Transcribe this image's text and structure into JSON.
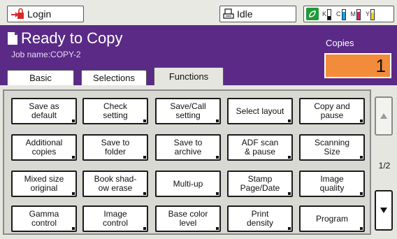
{
  "status_bar": {
    "login_label": "Login",
    "status_label": "Idle",
    "toner": [
      {
        "letter": "K",
        "level": 0.35,
        "color": "#111111"
      },
      {
        "letter": "C",
        "level": 0.8,
        "color": "#1aa0e0"
      },
      {
        "letter": "M",
        "level": 0.8,
        "color": "#d4237a"
      },
      {
        "letter": "Y",
        "level": 0.75,
        "color": "#f2d21a"
      }
    ]
  },
  "header": {
    "title": "Ready to Copy",
    "job_name": "Job name:COPY-2",
    "copies_label": "Copies",
    "copies_value": "1"
  },
  "tabs": [
    {
      "label": "Basic",
      "active": false
    },
    {
      "label": "Selections",
      "active": false
    },
    {
      "label": "Functions",
      "active": true
    }
  ],
  "functions": [
    "Save as\ndefault",
    "Check\nsetting",
    "Save/Call\nsetting",
    "Select layout",
    "Copy and\npause",
    "Additional\ncopies",
    "Save to\nfolder",
    "Save to\narchive",
    "ADF scan\n& pause",
    "Scanning\nSize",
    "Mixed size\noriginal",
    "Book shad-\now erase",
    "Multi-up",
    "Stamp\nPage/Date",
    "Image\nquality",
    "Gamma\ncontrol",
    "Image\ncontrol",
    "Base color\nlevel",
    "Print\ndensity",
    "Program"
  ],
  "pager": {
    "indicator": "1/2"
  }
}
